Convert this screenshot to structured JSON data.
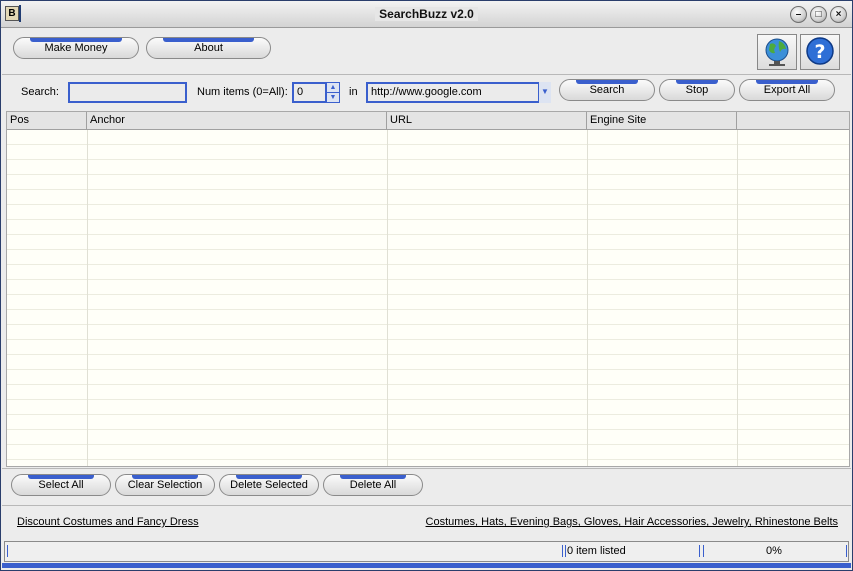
{
  "window": {
    "title": "SearchBuzz v2.0",
    "app_icon": "B"
  },
  "titlebar_buttons": {
    "minimize": "–",
    "maximize": "□",
    "close": "×"
  },
  "toolbar": {
    "make_money": "Make Money",
    "about": "About",
    "web_icon": "globe-icon",
    "help_icon": "help-icon"
  },
  "search": {
    "label": "Search:",
    "value": "",
    "num_label": "Num items (0=All):",
    "num_value": "0",
    "in_label": "in",
    "engine": "http://www.google.com",
    "search_btn": "Search",
    "stop_btn": "Stop",
    "export_btn": "Export All"
  },
  "table": {
    "columns": [
      "Pos",
      "Anchor",
      "URL",
      "Engine Site",
      ""
    ],
    "rows": []
  },
  "actions": {
    "select_all": "Select All",
    "clear_selection": "Clear Selection",
    "delete_selected": "Delete Selected",
    "delete_all": "Delete All"
  },
  "links": {
    "left": "Discount Costumes and Fancy Dress",
    "right": "Costumes, Hats, Evening Bags, Gloves, Hair Accessories, Jewelry, Rhinestone Belts"
  },
  "status": {
    "items": "0 item listed",
    "progress": "0%"
  },
  "colors": {
    "accent": "#3a5fcd"
  }
}
